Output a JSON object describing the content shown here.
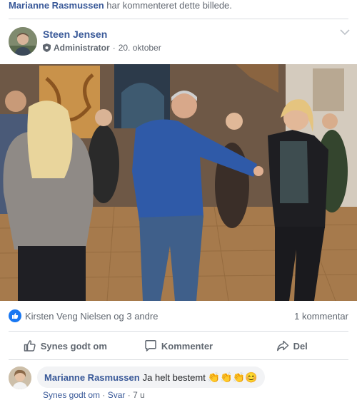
{
  "activity": {
    "actor": "Marianne Rasmussen",
    "text": "har kommenteret dette billede."
  },
  "post": {
    "author": "Steen Jensen",
    "role": "Administrator",
    "separator": "·",
    "date": "20. oktober",
    "photo_icon": "dancing-photo"
  },
  "reactions": {
    "icon": "like-icon",
    "names": "Kirsten Veng Nielsen og 3 andre",
    "comment_count": "1 kommentar"
  },
  "actions": {
    "like": "Synes godt om",
    "comment": "Kommenter",
    "share": "Del"
  },
  "comment": {
    "author": "Marianne Rasmussen",
    "text": "Ja helt bestemt",
    "emojis": "👏👏👏😊",
    "like_link": "Synes godt om",
    "reply_link": "Svar",
    "separator": "·",
    "age": "7 u"
  },
  "colors": {
    "link": "#385898",
    "like_blue": "#1877f2",
    "muted": "#606770",
    "divider": "#dadde1",
    "bubble": "#f2f3f5"
  }
}
